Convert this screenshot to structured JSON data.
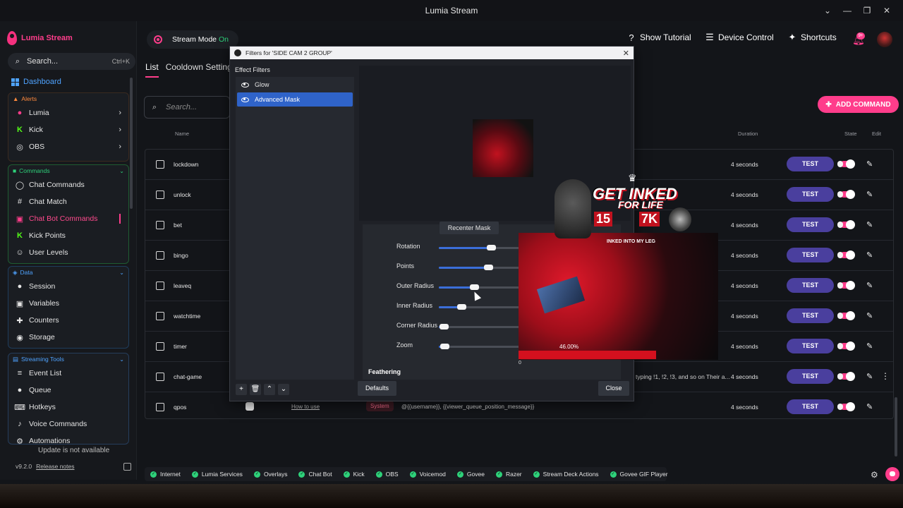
{
  "window": {
    "title": "Lumia Stream"
  },
  "brand": {
    "name": "Lumia Stream"
  },
  "sidebar": {
    "search_label": "Search...",
    "search_shortcut": "Ctrl+K",
    "dashboard": "Dashboard",
    "alerts": {
      "header": "Alerts",
      "items": [
        "Lumia",
        "Kick",
        "OBS"
      ]
    },
    "commands": {
      "header": "Commands",
      "items": [
        "Chat Commands",
        "Chat Match",
        "Chat Bot Commands",
        "Kick Points",
        "User Levels"
      ],
      "active": "Chat Bot Commands"
    },
    "data": {
      "header": "Data",
      "items": [
        "Session",
        "Variables",
        "Counters",
        "Storage"
      ]
    },
    "streaming_tools": {
      "header": "Streaming Tools",
      "items": [
        "Event List",
        "Queue",
        "Hotkeys",
        "Voice Commands",
        "Automations"
      ]
    },
    "update_status": "Update is not available",
    "version": "v9.2.0",
    "release_notes": "Release notes"
  },
  "topbar": {
    "stream_mode_label": "Stream Mode",
    "stream_mode_state": "On",
    "show_tutorial": "Show Tutorial",
    "device_control": "Device Control",
    "shortcuts": "Shortcuts",
    "notif_badge": "9+"
  },
  "main": {
    "tabs": [
      "List",
      "Cooldown Settings"
    ],
    "search_placeholder": "Search...",
    "add_command": "ADD COMMAND",
    "columns": {
      "name": "Name",
      "duration": "Duration",
      "state": "State",
      "edit": "Edit"
    },
    "test_label": "TEST",
    "rows": [
      {
        "name": "lockdown",
        "duration": "4 seconds"
      },
      {
        "name": "unlock",
        "duration": "4 seconds"
      },
      {
        "name": "bet",
        "duration": "4 seconds"
      },
      {
        "name": "bingo",
        "duration": "4 seconds"
      },
      {
        "name": "leaveq",
        "duration": "4 seconds"
      },
      {
        "name": "watchtime",
        "duration": "4 seconds"
      },
      {
        "name": "timer",
        "duration": "4 seconds"
      },
      {
        "name": "chat-game",
        "duration": "4 seconds",
        "description": "typing !1, !2, !3, and so on Their a..."
      },
      {
        "name": "qpos",
        "duration": "4 seconds",
        "how_to": "How to use",
        "source": "System",
        "message": "@{{username}}, {{viewer_queue_position_message}}"
      }
    ]
  },
  "statusbar": {
    "items": [
      "Internet",
      "Lumia Services",
      "Overlays",
      "Chat Bot",
      "Kick",
      "OBS",
      "Voicemod",
      "Govee",
      "Razer",
      "Stream Deck Actions",
      "Govee GIF Player"
    ]
  },
  "dialog": {
    "title": "Filters for 'SIDE CAM 2 GROUP'",
    "effect_filters_label": "Effect Filters",
    "filters": [
      "Glow",
      "Advanced Mask"
    ],
    "selected_filter": "Advanced Mask",
    "recenter_mask": "Recenter Mask",
    "sliders": [
      {
        "label": "Rotation",
        "value": 0.53
      },
      {
        "label": "Points",
        "value": 0.5
      },
      {
        "label": "Outer Radius",
        "value": 0.36
      },
      {
        "label": "Inner Radius",
        "value": 0.23
      },
      {
        "label": "Corner Radius",
        "value": 0.05
      },
      {
        "label": "Zoom",
        "value": 0.06
      }
    ],
    "feathering": "Feathering",
    "defaults": "Defaults",
    "close": "Close"
  },
  "overlay": {
    "line1": "GET INKED",
    "line2": "FOR LIFE",
    "gifted": "15",
    "kicks": "7K",
    "tagline": "INKED INTO MY LEG",
    "progress_pct": "46.00%",
    "progress_min": "0"
  },
  "colors": {
    "accent": "#ff3d8b",
    "test_button": "#4a3f9e",
    "status_ok": "#2ed17a",
    "dialog_selection": "#2f63c9"
  }
}
